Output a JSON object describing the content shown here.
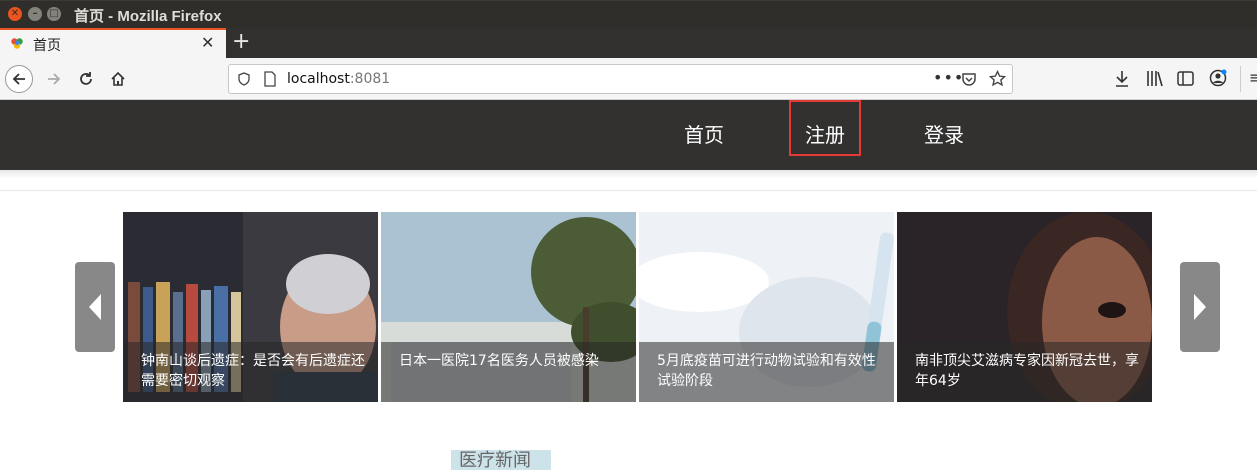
{
  "window": {
    "title": "首页 - Mozilla Firefox"
  },
  "tab": {
    "label": "首页"
  },
  "urlbar": {
    "host": "localhost",
    "port": ":8081"
  },
  "menu": {
    "home": "首页",
    "register": "注册",
    "login": "登录"
  },
  "carousel": {
    "items": [
      {
        "caption": "钟南山谈后遗症：是否会有后遗症还需要密切观察"
      },
      {
        "caption": "日本一医院17名医务人员被感染"
      },
      {
        "caption": "5月底疫苗可进行动物试验和有效性试验阶段"
      },
      {
        "caption": "南非顶尖艾滋病专家因新冠去世，享年64岁"
      }
    ]
  },
  "section": {
    "news_label": "医疗新闻"
  },
  "colors": {
    "header_bg": "#323130",
    "highlight_border": "#e53935",
    "accent": "#e95420"
  },
  "icons": [
    "close-icon",
    "minimize-icon",
    "maximize-icon",
    "back-icon",
    "forward-icon",
    "reload-icon",
    "home-icon",
    "shield-icon",
    "page-icon",
    "more-icon",
    "pocket-icon",
    "star-icon",
    "download-icon",
    "library-icon",
    "sidebar-icon",
    "account-icon",
    "menu-icon",
    "chevron-left-icon",
    "chevron-right-icon"
  ]
}
